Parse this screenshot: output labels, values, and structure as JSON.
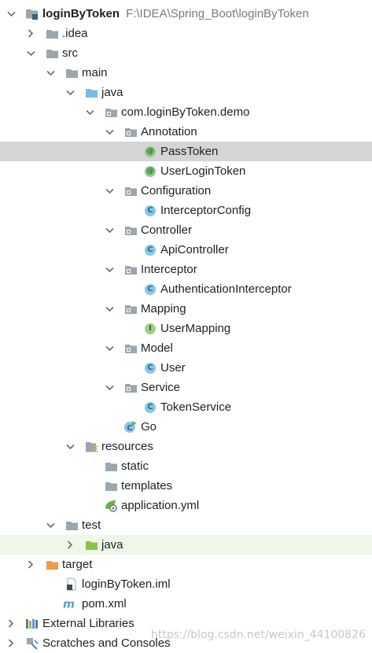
{
  "tree": [
    {
      "label": "loginByToken",
      "path": "F:\\IDEA\\Spring_Boot\\loginByToken",
      "depth": 0,
      "arrow": "down",
      "icon": "module-folder-icon",
      "bold": true
    },
    {
      "label": ".idea",
      "depth": 1,
      "arrow": "right",
      "icon": "folder-icon"
    },
    {
      "label": "src",
      "depth": 1,
      "arrow": "down",
      "icon": "folder-icon"
    },
    {
      "label": "main",
      "depth": 2,
      "arrow": "down",
      "icon": "folder-icon"
    },
    {
      "label": "java",
      "depth": 3,
      "arrow": "down",
      "icon": "source-folder-icon"
    },
    {
      "label": "com.loginByToken.demo",
      "depth": 4,
      "arrow": "down",
      "icon": "package-icon"
    },
    {
      "label": "Annotation",
      "depth": 5,
      "arrow": "down",
      "icon": "package-icon"
    },
    {
      "label": "PassToken",
      "depth": 6,
      "arrow": "none",
      "icon": "annotation-icon",
      "selected": true
    },
    {
      "label": "UserLoginToken",
      "depth": 6,
      "arrow": "none",
      "icon": "annotation-icon"
    },
    {
      "label": "Configuration",
      "depth": 5,
      "arrow": "down",
      "icon": "package-icon"
    },
    {
      "label": "InterceptorConfig",
      "depth": 6,
      "arrow": "none",
      "icon": "class-icon"
    },
    {
      "label": "Controller",
      "depth": 5,
      "arrow": "down",
      "icon": "package-icon"
    },
    {
      "label": "ApiController",
      "depth": 6,
      "arrow": "none",
      "icon": "class-icon"
    },
    {
      "label": "Interceptor",
      "depth": 5,
      "arrow": "down",
      "icon": "package-icon"
    },
    {
      "label": "AuthenticationInterceptor",
      "depth": 6,
      "arrow": "none",
      "icon": "class-icon"
    },
    {
      "label": "Mapping",
      "depth": 5,
      "arrow": "down",
      "icon": "package-icon"
    },
    {
      "label": "UserMapping",
      "depth": 6,
      "arrow": "none",
      "icon": "interface-icon"
    },
    {
      "label": "Model",
      "depth": 5,
      "arrow": "down",
      "icon": "package-icon"
    },
    {
      "label": "User",
      "depth": 6,
      "arrow": "none",
      "icon": "class-icon"
    },
    {
      "label": "Service",
      "depth": 5,
      "arrow": "down",
      "icon": "package-icon"
    },
    {
      "label": "TokenService",
      "depth": 6,
      "arrow": "none",
      "icon": "class-icon"
    },
    {
      "label": "Go",
      "depth": 5,
      "arrow": "none",
      "icon": "spring-boot-class-icon"
    },
    {
      "label": "resources",
      "depth": 3,
      "arrow": "down",
      "icon": "resources-folder-icon"
    },
    {
      "label": "static",
      "depth": 4,
      "arrow": "none",
      "icon": "folder-icon"
    },
    {
      "label": "templates",
      "depth": 4,
      "arrow": "none",
      "icon": "folder-icon"
    },
    {
      "label": "application.yml",
      "depth": 4,
      "arrow": "none",
      "icon": "yaml-config-icon"
    },
    {
      "label": "test",
      "depth": 2,
      "arrow": "down",
      "icon": "folder-icon"
    },
    {
      "label": "java",
      "depth": 3,
      "arrow": "right",
      "icon": "test-source-folder-icon",
      "highlight": "test"
    },
    {
      "label": "target",
      "depth": 1,
      "arrow": "right",
      "icon": "excluded-folder-icon"
    },
    {
      "label": "loginByToken.iml",
      "depth": 2,
      "arrow": "none",
      "icon": "iml-file-icon"
    },
    {
      "label": "pom.xml",
      "depth": 2,
      "arrow": "none",
      "icon": "maven-icon"
    },
    {
      "label": "External Libraries",
      "depth": 0,
      "arrow": "right",
      "icon": "libraries-icon"
    },
    {
      "label": "Scratches and Consoles",
      "depth": 0,
      "arrow": "right",
      "icon": "scratches-icon"
    }
  ],
  "watermark": "https://blog.csdn.net/weixin_44100826",
  "colors": {
    "folder": "#9aa7b0",
    "source_folder": "#7fb9e6",
    "test_folder": "#8bc34a",
    "excluded_folder": "#f29b4b",
    "class_badge": "#8ac6e6",
    "annotation_badge": "#8fcf8a",
    "selection": "#d5d5d5"
  }
}
